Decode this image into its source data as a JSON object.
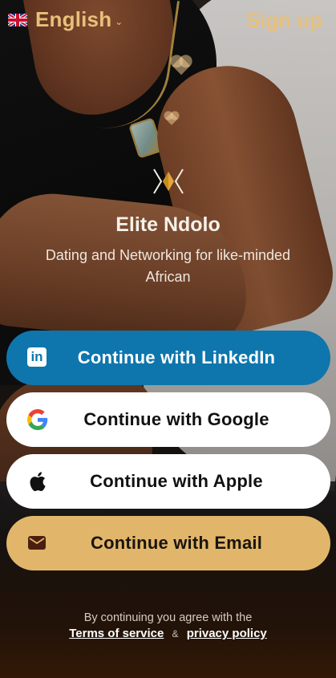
{
  "header": {
    "language_label": "English",
    "signup_label": "Sign up"
  },
  "brand": {
    "name": "Elite Ndolo",
    "tagline": "Dating and Networking for like-minded African"
  },
  "auth_buttons": {
    "linkedin": "Continue with LinkedIn",
    "google": "Continue with Google",
    "apple": "Continue with Apple",
    "email": "Continue with Email"
  },
  "legal": {
    "notice": "By continuing you agree with the",
    "terms_label": "Terms of service",
    "separator": "&",
    "privacy_label": "privacy policy"
  },
  "icons": {
    "flag": "uk-flag-icon",
    "chevron": "chevron-down-icon",
    "logo": "elite-ndolo-logo",
    "linkedin": "linkedin-icon",
    "google": "google-icon",
    "apple": "apple-icon",
    "email": "envelope-icon"
  },
  "colors": {
    "accent_gold": "#e8c07a",
    "linkedin_blue": "#0e76ad",
    "email_button": "#e2b66a"
  }
}
